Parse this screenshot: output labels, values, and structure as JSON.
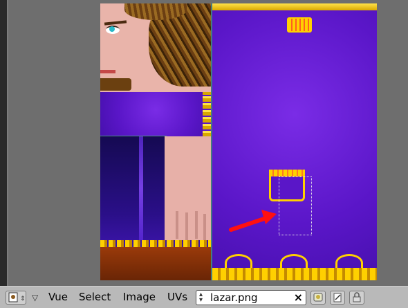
{
  "header": {
    "menus": [
      {
        "id": "vue",
        "label": "Vue"
      },
      {
        "id": "select",
        "label": "Select"
      },
      {
        "id": "image",
        "label": "Image"
      },
      {
        "id": "uvs",
        "label": "UVs"
      }
    ],
    "image_name": "lazar.png"
  },
  "colors": {
    "texture_purple": "#5a16c8",
    "gold": "#ffd000",
    "skin": "#e9b4aa",
    "arrow": "#ff1010",
    "header_bg": "#b9b9b9"
  },
  "icons": [
    "editor-type-icon",
    "header-collapse-icon",
    "image-browse-icon",
    "image-clear-icon",
    "pin-icon",
    "sync-icon",
    "lock-icon"
  ]
}
